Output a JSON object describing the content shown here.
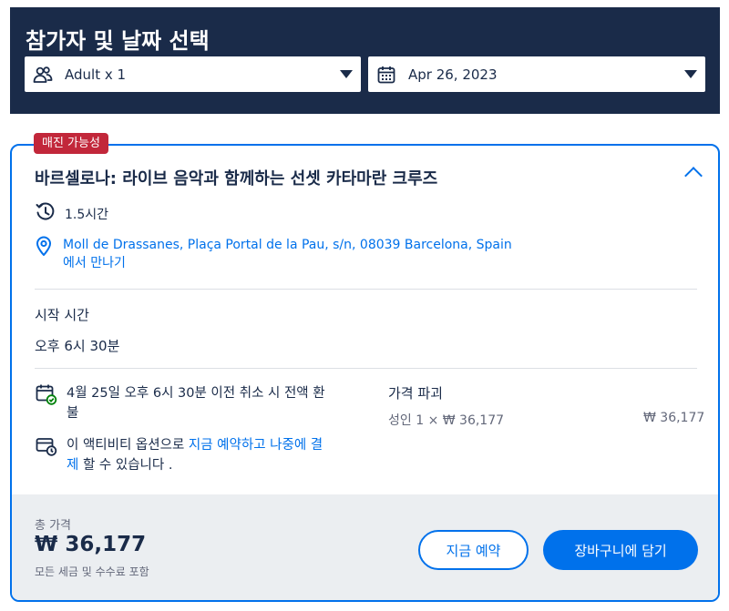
{
  "header": {
    "title": "참가자 및 날짜 선택",
    "participants": {
      "value": "Adult x 1",
      "icon": "people-icon"
    },
    "date": {
      "value": "Apr 26, 2023",
      "icon": "calendar-icon"
    }
  },
  "option": {
    "badge": "매진 가능성",
    "title": "바르셀로나: 라이브 음악과 함께하는 선셋 카타마란 크루즈",
    "duration": "1.5시간",
    "meeting_point": "Moll de Drassanes, Plaça Portal de la Pau, s/n, 08039 Barcelona, Spain",
    "meeting_suffix": "에서 만나기",
    "start_time_label": "시작 시간",
    "start_time_value": "오후 6시 30분",
    "cancellation": "4월 25일 오후 6시 30분 이전 취소 시 전액 환불",
    "reserve_prefix": "이 액티비티 옵션으로 ",
    "reserve_link": "지금 예약하고 나중에 결제",
    "reserve_suffix": " 할 수 있습니다 .",
    "breakdown": {
      "label": "가격 파괴",
      "line": "성인 1 × ₩ 36,177",
      "amount": "₩ 36,177"
    }
  },
  "footer": {
    "total_label": "총 가격",
    "total_value": "₩ 36,177",
    "total_note": "모든 세금 및 수수료 포함",
    "book_now": "지금 예약",
    "add_to_cart": "장바구니에 담기"
  },
  "colors": {
    "navy": "#1a2b49",
    "accent": "#0071eb",
    "badge": "#c2273a",
    "footer_bg": "#ebeef1"
  }
}
